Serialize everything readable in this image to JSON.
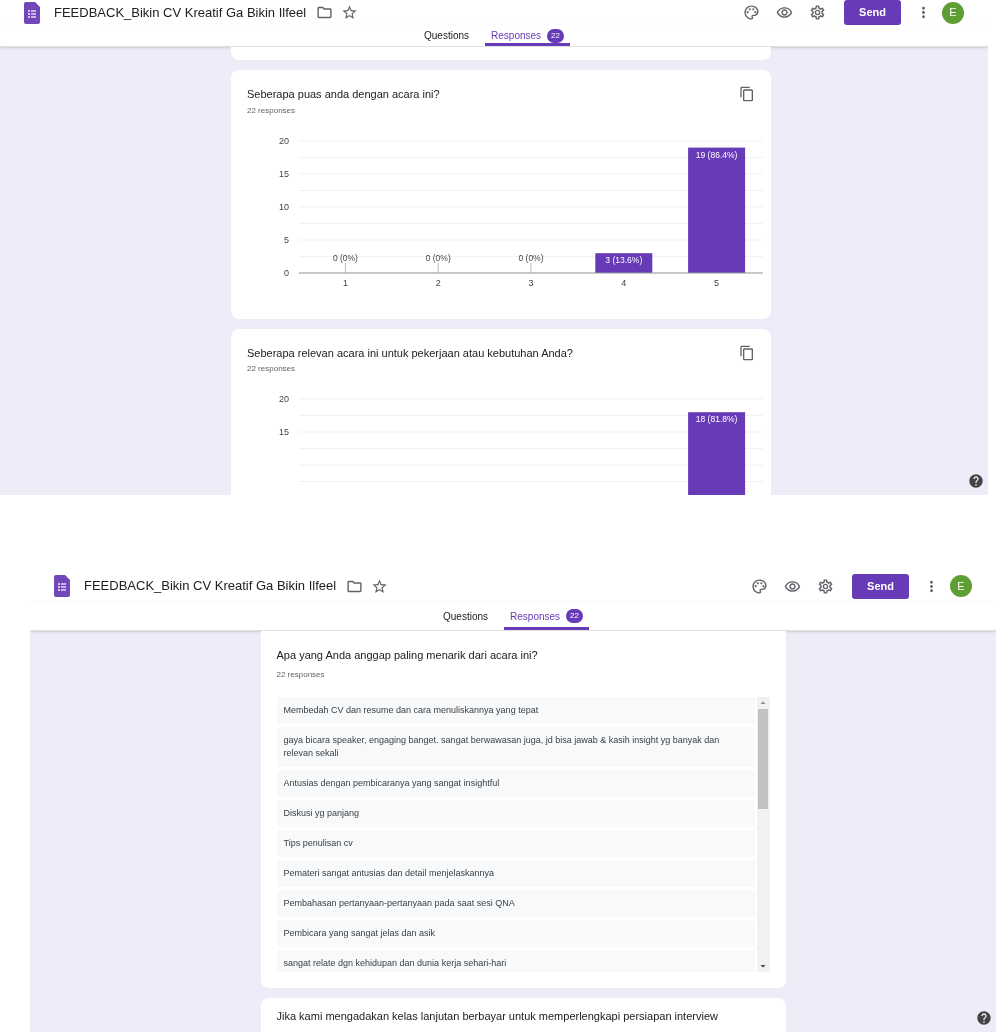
{
  "screenshots": [
    {
      "header": {
        "title": "FEEDBACK_Bikin CV Kreatif Ga Bikin Ilfeel",
        "send_button": "Send",
        "avatar": "E"
      },
      "tabs": [
        {
          "label": "Questions",
          "selected": false
        },
        {
          "label": "Responses",
          "selected": true,
          "badge": "22"
        }
      ],
      "cards": [
        {
          "kind": "stub"
        },
        {
          "kind": "chart",
          "title": "Seberapa puas anda dengan acara ini?",
          "count": "22 responses",
          "chart_data": {
            "type": "bar",
            "categories": [
              "1",
              "2",
              "3",
              "4",
              "5"
            ],
            "values": [
              0,
              0,
              0,
              3,
              19
            ],
            "value_labels": [
              "0 (0%)",
              "0 (0%)",
              "0 (0%)",
              "3 (13.6%)",
              "19 (86.4%)"
            ],
            "ylim": [
              0,
              20
            ],
            "yticks": [
              0,
              5,
              10,
              15,
              20
            ],
            "grid": true,
            "color": "#673ab7"
          }
        },
        {
          "kind": "chart",
          "title": "Seberapa relevan acara ini untuk pekerjaan atau kebutuhan Anda?",
          "count": "22 responses",
          "chart_data": {
            "type": "bar",
            "values": [
              null,
              null,
              null,
              null,
              18
            ],
            "value_labels": [
              null,
              null,
              null,
              null,
              "18 (81.8%)"
            ],
            "ylim": [
              0,
              20
            ],
            "yticks": [
              15,
              20
            ],
            "grid": true,
            "color": "#673ab7"
          }
        }
      ]
    },
    {
      "header": {
        "title": "FEEDBACK_Bikin CV Kreatif Ga Bikin Ilfeel",
        "send_button": "Send",
        "avatar": "E"
      },
      "tabs": [
        {
          "label": "Questions",
          "selected": false
        },
        {
          "label": "Responses",
          "selected": true,
          "badge": "22"
        }
      ],
      "cards": [
        {
          "kind": "text_list",
          "title": "Apa yang Anda anggap paling menarik dari acara ini?",
          "count": "22 responses",
          "answers": [
            "Membedah CV dan resume dan cara menuliskannya yang tepat",
            "gaya bicara speaker, engaging banget. sangat berwawasan juga, jd bisa jawab & kasih insight yg banyak dan relevan sekali",
            "Antusias dengan pembicaranya yang sangat insightful",
            "Diskusi yg panjang",
            "Tips penulisan cv",
            "Pemateri sangat antusias dan detail menjelaskannya",
            "Pembahasan pertanyaan-pertanyaan pada saat sesi QNA",
            "Pembicara yang sangat jelas dan asik",
            "sangat relate dgn kehidupan dan dunia kerja sehari-hari"
          ]
        },
        {
          "kind": "heading",
          "title": "Jika kami mengadakan kelas lanjutan berbayar untuk memperlengkapi persiapan interview"
        }
      ]
    }
  ]
}
